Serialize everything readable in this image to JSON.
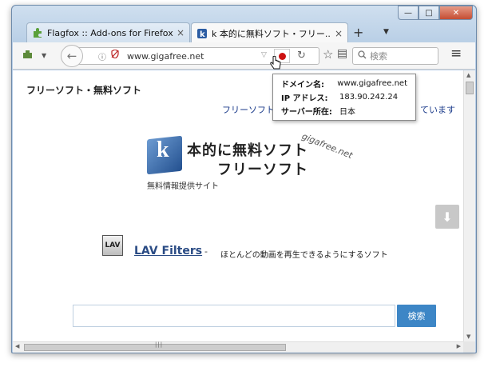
{
  "window": {
    "controls": {
      "minimize": "—",
      "maximize": "□",
      "close": "✕"
    }
  },
  "tabs": [
    {
      "label": "Flagfox :: Add-ons for Firefox",
      "icon": "puzzle-icon",
      "close": "×"
    },
    {
      "label": "k 本的に無料ソフト・フリー...",
      "icon": "k-site-icon",
      "close": "×"
    }
  ],
  "tabstrip": {
    "new_tab": "+",
    "tabs_menu": "▼"
  },
  "toolbar": {
    "back": "←",
    "url": "www.gigafree.net",
    "info": "ⓘ",
    "shield": "🛡",
    "dropdown": "▽",
    "reload": "↻",
    "bookmark": "☆",
    "reader": "▤",
    "search_placeholder": "検索",
    "menu": "≡"
  },
  "flagfox_popup": {
    "rows": [
      {
        "key": "ドメイン名:",
        "value": "www.gigafree.net"
      },
      {
        "key": "IP アドレス:",
        "value": "183.90.242.24"
      },
      {
        "key": "サーバー所在:",
        "value": "日本"
      }
    ]
  },
  "page": {
    "title": "フリーソフト・無料ソフト",
    "subtitle": "フリーソフト・",
    "subtitle_tail": "ています",
    "logo": {
      "letter": "k",
      "line1": "本的に無料ソフト",
      "line2": "フリーソフト",
      "sub": "無料情報提供サイト",
      "domain": "gigafree.net"
    },
    "download_icon": "⬇",
    "featured": {
      "icon_text": "LAV",
      "link": "LAV Filters",
      "dash": "-",
      "description": "ほとんどの動画を再生できるようにするソフト"
    },
    "search_button": "検索"
  },
  "scrollbars": {
    "up": "▲",
    "down": "▼",
    "left": "◀",
    "right": "▶",
    "grip": "|||"
  },
  "colors": {
    "accent": "#3d86c6",
    "flagfox_dot": "#cc1111",
    "link": "#2a4b84"
  }
}
